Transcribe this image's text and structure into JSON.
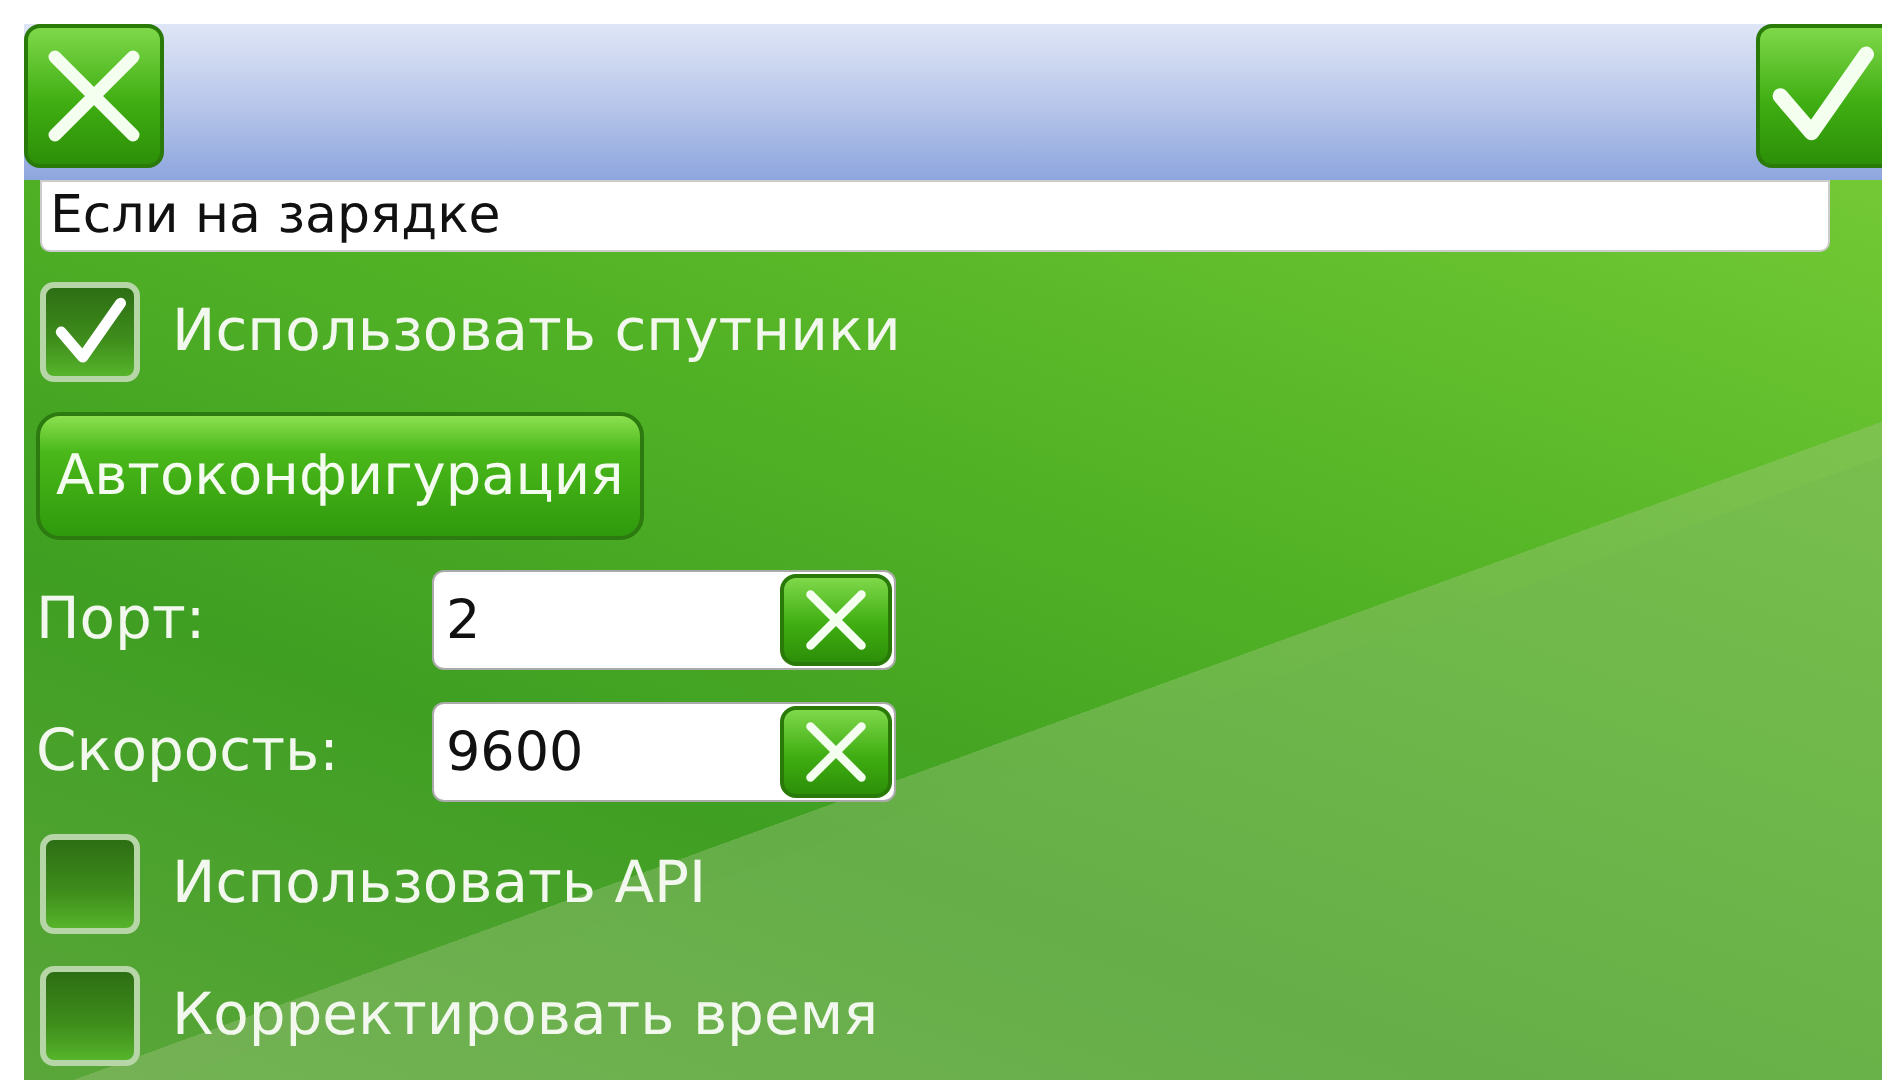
{
  "mode_field": {
    "value": "Если на зарядке"
  },
  "options": [
    {
      "kind": "checkbox",
      "label": "Использовать спутники",
      "checked": true
    },
    {
      "kind": "button",
      "label": "Автоконфигурация"
    },
    {
      "kind": "input",
      "label": "Порт:",
      "value": "2"
    },
    {
      "kind": "input",
      "label": "Скорость:",
      "value": "9600"
    },
    {
      "kind": "checkbox",
      "label": "Использовать API",
      "checked": false
    },
    {
      "kind": "checkbox",
      "label": "Корректировать время",
      "checked": false
    }
  ]
}
